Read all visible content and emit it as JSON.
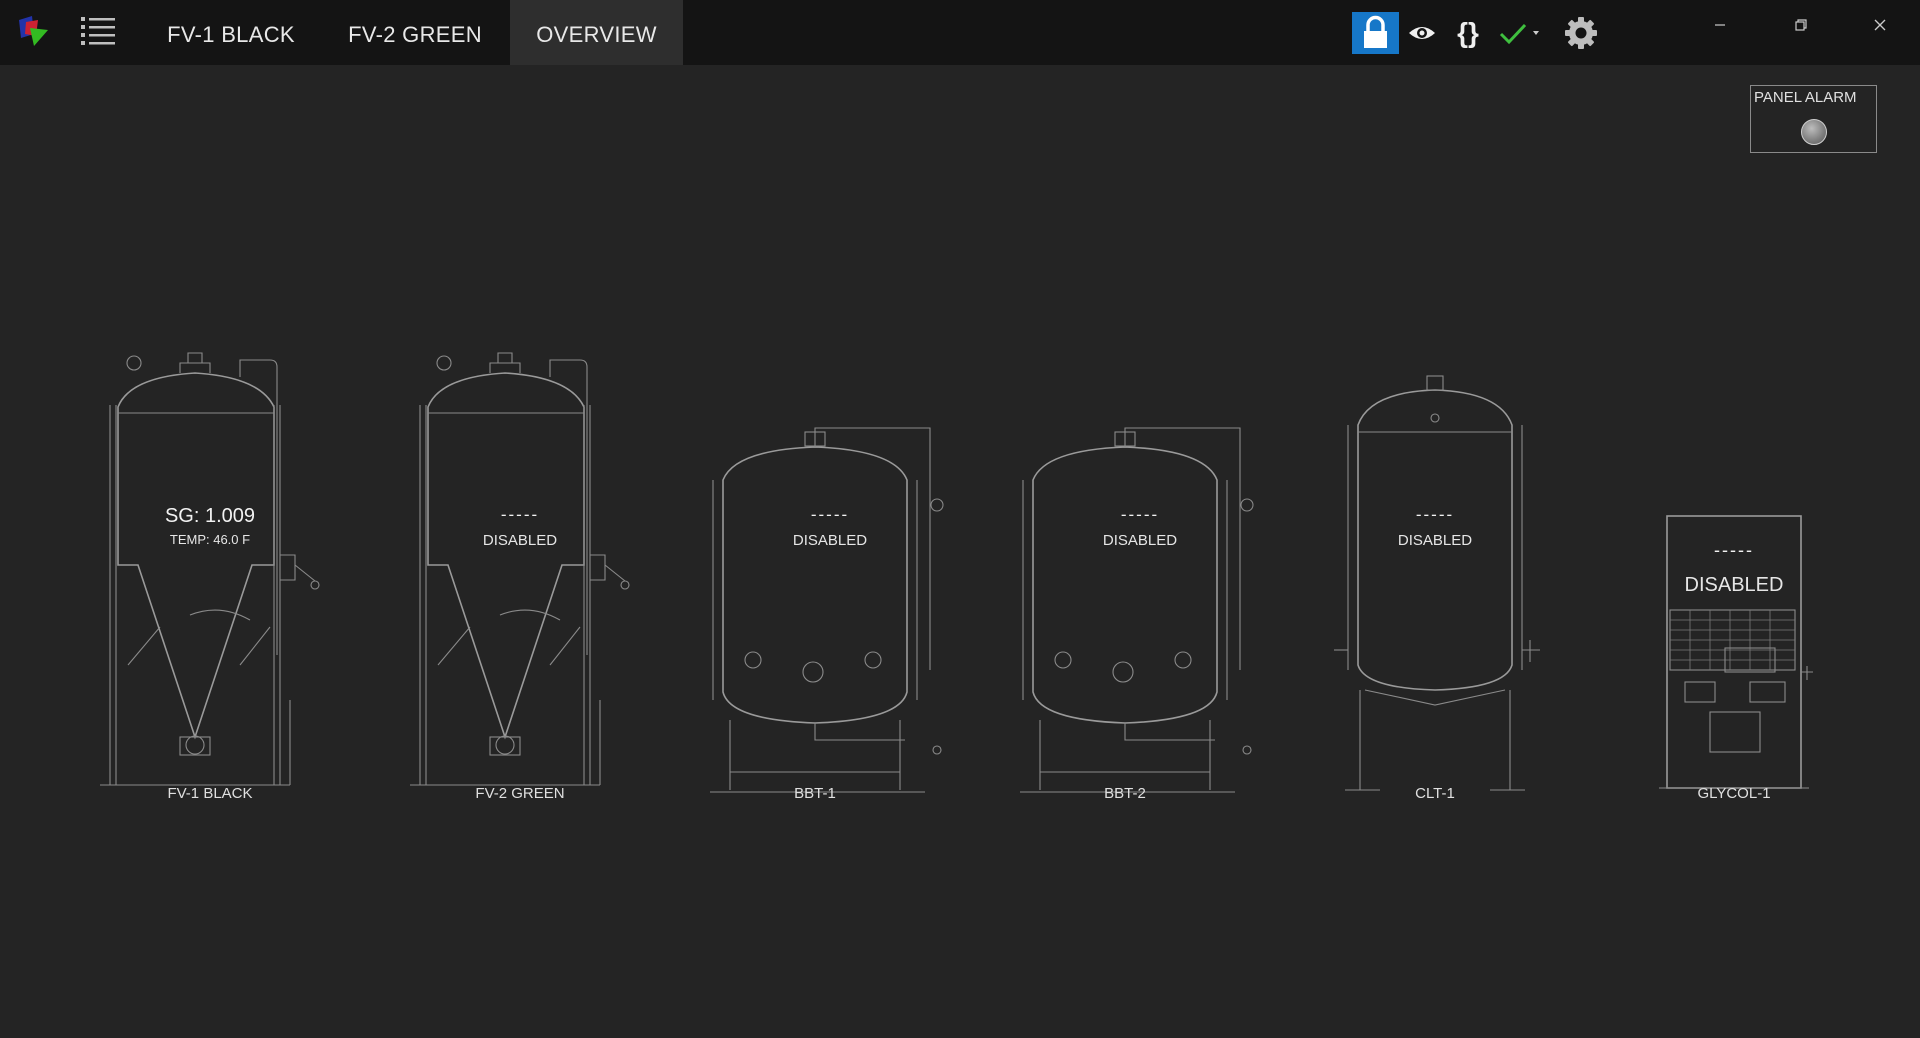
{
  "tabs": [
    {
      "label": "FV-1 BLACK",
      "active": false
    },
    {
      "label": "FV-2 GREEN",
      "active": false
    },
    {
      "label": "OVERVIEW",
      "active": true
    }
  ],
  "toolbar": {
    "lock_icon": "lock-icon",
    "view_icon": "eye-icon",
    "code_label": "{}",
    "status_icon": "check-icon",
    "settings_icon": "gear-icon"
  },
  "panel_alarm": {
    "label": "PANEL ALARM",
    "state": "off"
  },
  "vessels": [
    {
      "name": "FV-1 BLACK",
      "type": "fermenter",
      "primary": "SG: 1.009",
      "secondary": "TEMP: 46.0 F"
    },
    {
      "name": "FV-2 GREEN",
      "type": "fermenter",
      "primary": "-----",
      "secondary": "DISABLED"
    },
    {
      "name": "BBT-1",
      "type": "brite-tank",
      "primary": "-----",
      "secondary": "DISABLED"
    },
    {
      "name": "BBT-2",
      "type": "brite-tank",
      "primary": "-----",
      "secondary": "DISABLED"
    },
    {
      "name": "CLT-1",
      "type": "liquor-tank",
      "primary": "-----",
      "secondary": "DISABLED"
    },
    {
      "name": "GLYCOL-1",
      "type": "glycol-chiller",
      "primary": "-----",
      "secondary": "DISABLED"
    }
  ],
  "colors": {
    "background": "#242424",
    "topbar": "#141414",
    "active_tab": "#2e2e2e",
    "lock_accent": "#1677c8",
    "check_green": "#3fbf3f",
    "drawing_stroke": "#9a9a9a"
  }
}
